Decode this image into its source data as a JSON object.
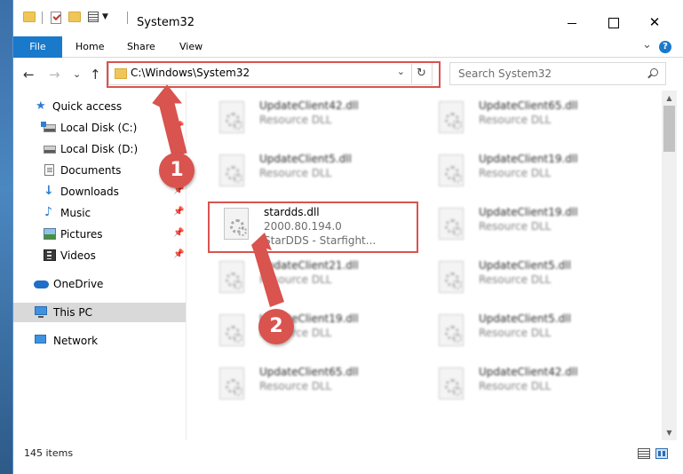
{
  "window": {
    "title": "System32",
    "controls": {
      "minimize": "",
      "maximize": "",
      "close": "✕"
    }
  },
  "ribbon": {
    "tabs": [
      "File",
      "Home",
      "Share",
      "View"
    ],
    "expand_glyph": "⌄",
    "help_glyph": "?"
  },
  "nav": {
    "back": "←",
    "forward": "→",
    "recent": "⌄",
    "up": "↑",
    "address": "C:\\Windows\\System32",
    "address_dropdown": "⌄",
    "refresh": "↻",
    "search_placeholder": "Search System32"
  },
  "sidebar": {
    "items": [
      {
        "label": "Quick access",
        "icon": "star-icon",
        "pinned": false
      },
      {
        "label": "Local Disk (C:)",
        "icon": "drive-c-icon",
        "pinned": true
      },
      {
        "label": "Local Disk (D:)",
        "icon": "drive-icon",
        "pinned": true
      },
      {
        "label": "Documents",
        "icon": "documents-icon",
        "pinned": true
      },
      {
        "label": "Downloads",
        "icon": "downloads-icon",
        "pinned": true
      },
      {
        "label": "Music",
        "icon": "music-icon",
        "pinned": true
      },
      {
        "label": "Pictures",
        "icon": "pictures-icon",
        "pinned": true
      },
      {
        "label": "Videos",
        "icon": "videos-icon",
        "pinned": true
      },
      {
        "label": "OneDrive",
        "icon": "onedrive-icon",
        "pinned": false
      },
      {
        "label": "This PC",
        "icon": "this-pc-icon",
        "pinned": false,
        "selected": true
      },
      {
        "label": "Network",
        "icon": "network-icon",
        "pinned": false
      }
    ],
    "pin_glyph": "📌"
  },
  "files": {
    "left": [
      {
        "name": "UpdateClient42.dll",
        "type": "Resource DLL"
      },
      {
        "name": "UpdateClient5.dll",
        "type": "Resource DLL"
      },
      {
        "name": "stardds.dll",
        "version": "2000.80.194.0",
        "company": "StarDDS - Starfight..."
      },
      {
        "name": "UpdateClient21.dll",
        "type": "Resource DLL"
      },
      {
        "name": "UpdateClient19.dll",
        "type": "Resource DLL"
      },
      {
        "name": "UpdateClient65.dll",
        "type": "Resource DLL"
      }
    ],
    "right": [
      {
        "name": "UpdateClient65.dll",
        "type": "Resource DLL"
      },
      {
        "name": "UpdateClient19.dll",
        "type": "Resource DLL"
      },
      {
        "name": "UpdateClient19.dll",
        "type": "Resource DLL"
      },
      {
        "name": "UpdateClient5.dll",
        "type": "Resource DLL"
      },
      {
        "name": "UpdateClient5.dll",
        "type": "Resource DLL"
      },
      {
        "name": "UpdateClient42.dll",
        "type": "Resource DLL"
      }
    ]
  },
  "scrollbar": {
    "up": "▲",
    "down": "▼"
  },
  "status": {
    "item_count": "145 items"
  },
  "annotations": {
    "step1": "1",
    "step2": "2",
    "color": "#d9534f"
  }
}
